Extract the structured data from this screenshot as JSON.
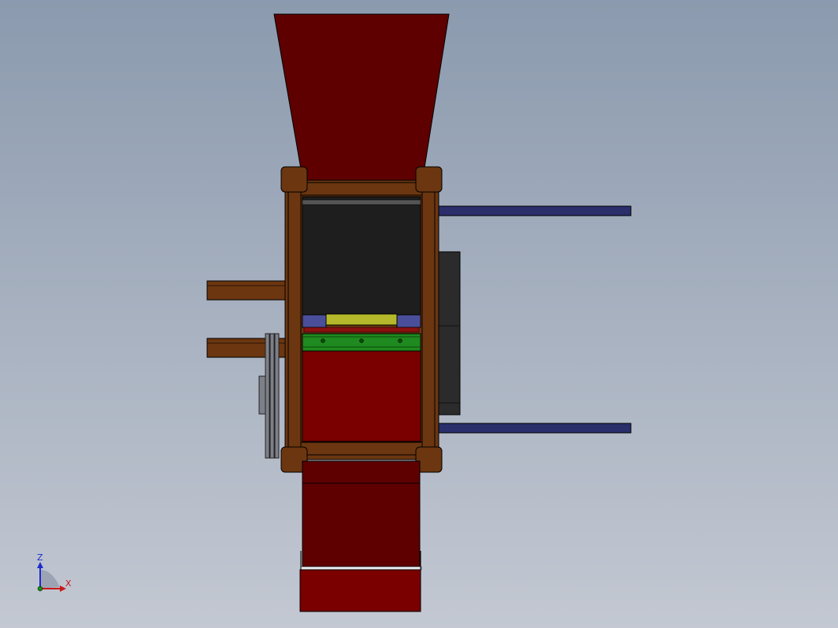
{
  "view": {
    "background_top": "#8b9aae",
    "background_bottom": "#c3c8d2"
  },
  "triad": {
    "z_label": "Z",
    "x_label": "X",
    "z_color": "#1c2bd0",
    "x_color": "#c81818",
    "icons": [
      "triad-z-arrow",
      "triad-x-arrow",
      "triad-origin-dot"
    ]
  },
  "colors": {
    "hopper": "#5e0000",
    "frame": "#6b3610",
    "corner_block": "#6b3610",
    "rod": "#2a2e6b",
    "dark_panel": "#1e1e1e",
    "motor": "#2b2b2b",
    "green_plate": "#1f8a1f",
    "yellow_plate": "#b5b82a",
    "blue_block": "#4a4f9a",
    "lower_chute": "#7a0000",
    "pulley": "#7d8088"
  }
}
